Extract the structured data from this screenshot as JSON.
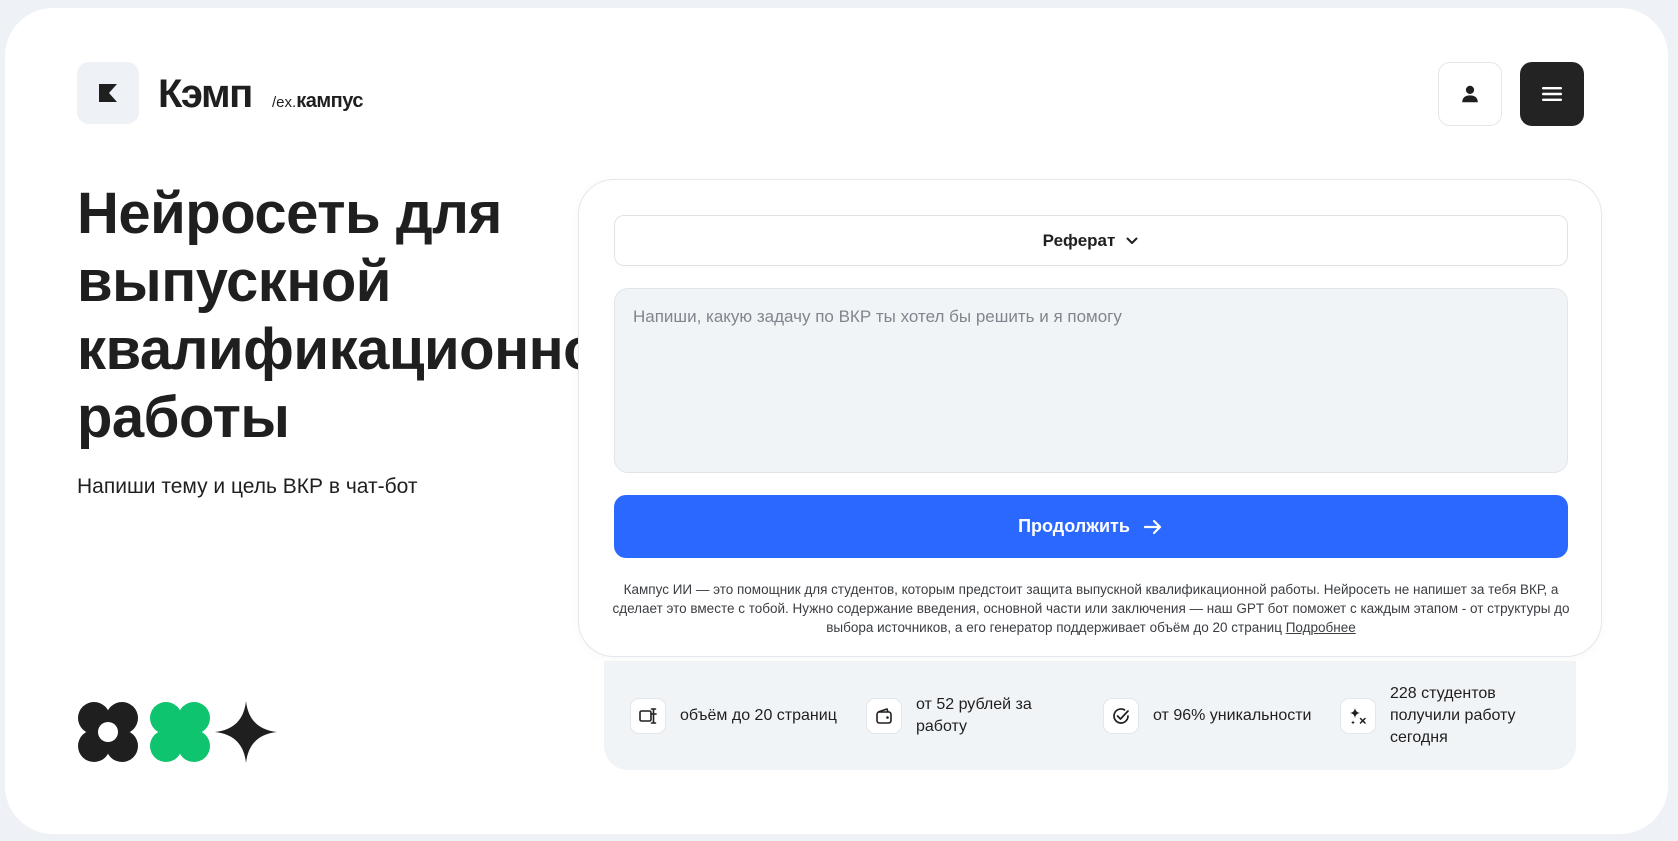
{
  "header": {
    "brand_name": "Кэмп",
    "brand_sub_prefix": "/ex.",
    "brand_sub_name": "кампус",
    "logo_icon": "k-logo-icon",
    "profile_icon": "user-icon",
    "menu_icon": "hamburger-icon"
  },
  "hero": {
    "title": "Нейросеть для\nвыпускной\nквалификационной\nработы",
    "subtitle": "Напиши тему и цель ВКР в чат-бот"
  },
  "form": {
    "work_type": "Реферат",
    "prompt_placeholder": "Напиши, какую задачу по ВКР ты хотел бы решить и я помогу",
    "prompt_value": "",
    "continue_label": "Продолжить",
    "disclaimer": "Кампус ИИ — это помощник для студентов, которым предстоит защита выпускной квалификационной работы. Нейросеть не напишет за тебя ВКР, а сделает это вместе с тобой. Нужно содержание введения, основной части или заключения — наш GPT бот поможет с каждым этапом - от структуры до выбора источников, а его генератор поддерживает объём до 20 страниц",
    "more_link": "Подробнее"
  },
  "features": [
    {
      "icon": "pages-icon",
      "text": "объём до 20 страниц"
    },
    {
      "icon": "wallet-icon",
      "text": "от 52 рублей за работу"
    },
    {
      "icon": "check-circle-icon",
      "text": "от 96% уникальности"
    },
    {
      "icon": "sparkles-icon",
      "text": "228 студентов получили работу сегодня"
    }
  ],
  "colors": {
    "accent_blue": "#2A68FF",
    "accent_green": "#0FC46E",
    "dark": "#232323",
    "soft_bg": "#F1F4F7"
  }
}
